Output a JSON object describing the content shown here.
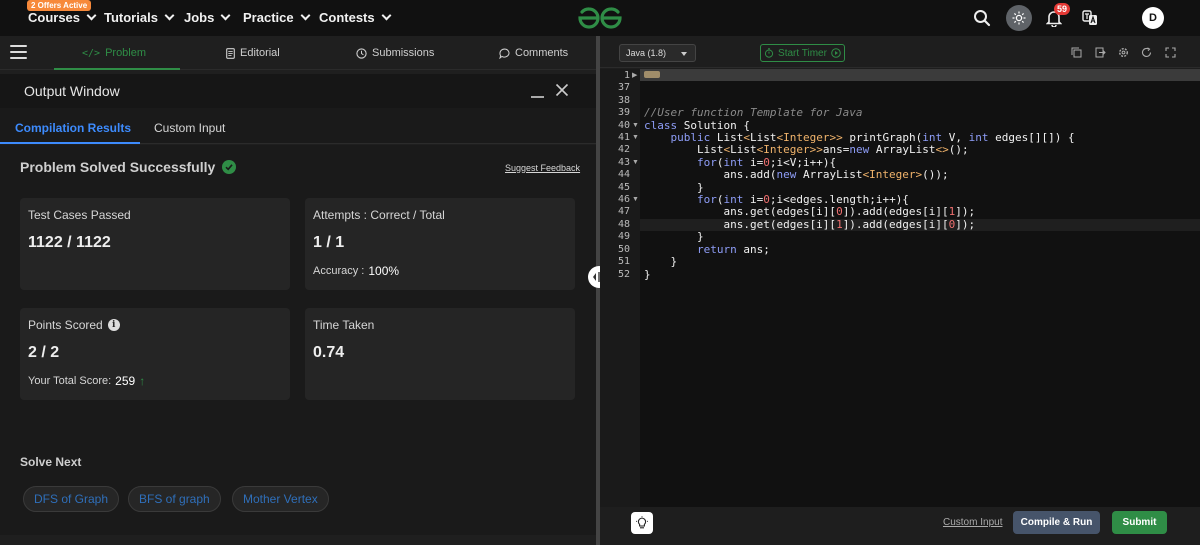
{
  "navbar": {
    "offer_badge": "2 Offers Active",
    "items": [
      {
        "label": "Courses"
      },
      {
        "label": "Tutorials"
      },
      {
        "label": "Jobs"
      },
      {
        "label": "Practice"
      },
      {
        "label": "Contests"
      }
    ],
    "notification_count": "59",
    "avatar_initial": "D",
    "brand_color": "#2f8d46"
  },
  "problem_tabs": {
    "problem": "Problem",
    "editorial": "Editorial",
    "submissions": "Submissions",
    "comments": "Comments"
  },
  "output_window": {
    "title": "Output Window",
    "tabs": {
      "compilation": "Compilation Results",
      "custom_input": "Custom Input"
    },
    "status": "Problem Solved Successfully",
    "suggest_feedback": "Suggest Feedback",
    "cards": {
      "test_cases": {
        "label": "Test Cases Passed",
        "value": "1122 / 1122"
      },
      "attempts": {
        "label": "Attempts : Correct / Total",
        "value": "1 / 1",
        "accuracy_label": "Accuracy :",
        "accuracy_value": "100%"
      },
      "points": {
        "label": "Points Scored",
        "value": "2 / 2",
        "total_label": "Your Total Score:",
        "total_value": "259"
      },
      "time": {
        "label": "Time Taken",
        "value": "0.74"
      }
    },
    "solve_next": {
      "heading": "Solve Next",
      "items": [
        "DFS of Graph",
        "BFS of graph",
        "Mother Vertex"
      ]
    }
  },
  "editor": {
    "language": "Java (1.8)",
    "start_timer": "Start Timer",
    "line_numbers": [
      "1",
      "37",
      "38",
      "39",
      "40",
      "41",
      "42",
      "43",
      "44",
      "45",
      "46",
      "47",
      "48",
      "49",
      "50",
      "51",
      "52"
    ],
    "custom_input": "Custom Input",
    "compile_run": "Compile & Run",
    "submit": "Submit"
  }
}
